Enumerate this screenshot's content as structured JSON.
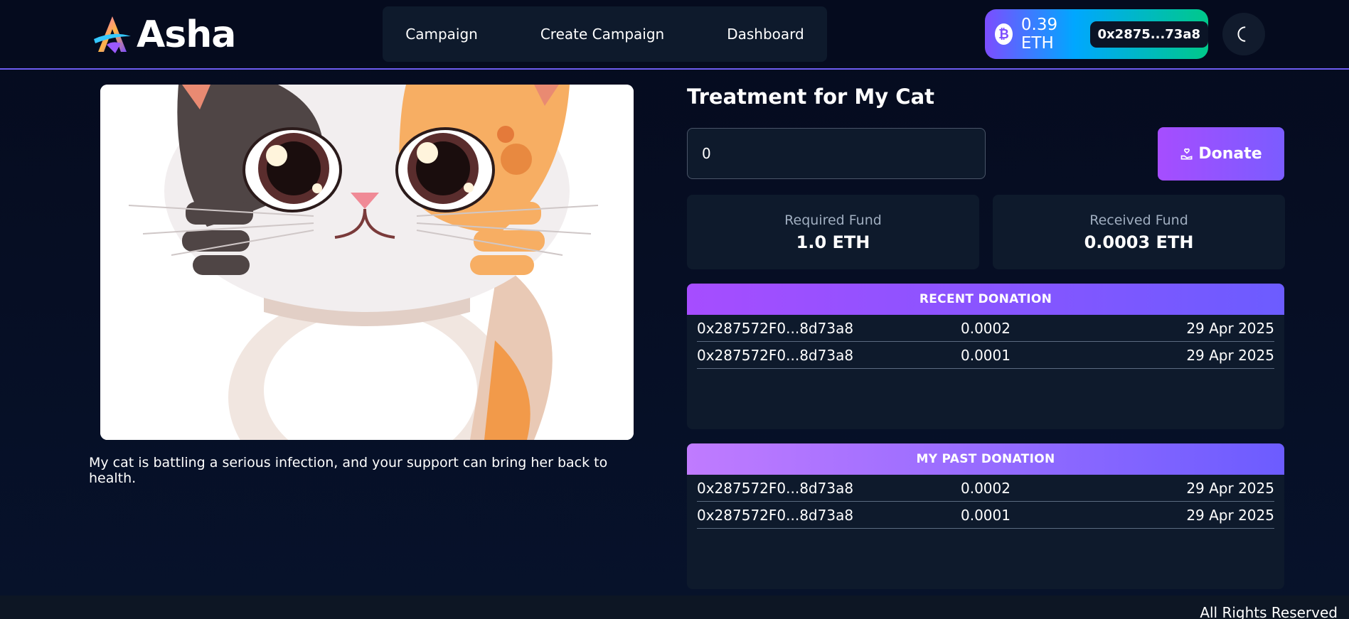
{
  "header": {
    "brand": "Asha",
    "nav": [
      "Campaign",
      "Create Campaign",
      "Dashboard"
    ],
    "wallet": {
      "coin_icon": "bitcoin-icon",
      "balance": "0.39 ETH",
      "address": "0x2875...73a8"
    },
    "theme_icon": "moon-icon"
  },
  "campaign": {
    "title": "Treatment for My Cat",
    "description": "My cat is battling a serious infection, and your support can bring her back to health.",
    "amount_value": "0",
    "donate_label": "Donate",
    "required_label": "Required Fund",
    "required_value": "1.0 ETH",
    "received_label": "Received Fund",
    "received_value": "0.0003 ETH"
  },
  "recent_donations": {
    "title": "RECENT DONATION",
    "rows": [
      {
        "address": "0x287572F0...8d73a8",
        "amount": "0.0002",
        "date": "29 Apr 2025"
      },
      {
        "address": "0x287572F0...8d73a8",
        "amount": "0.0001",
        "date": "29 Apr 2025"
      }
    ]
  },
  "past_donations": {
    "title": "MY PAST DONATION",
    "rows": [
      {
        "address": "0x287572F0...8d73a8",
        "amount": "0.0002",
        "date": "29 Apr 2025"
      },
      {
        "address": "0x287572F0...8d73a8",
        "amount": "0.0001",
        "date": "29 Apr 2025"
      }
    ]
  },
  "footer": {
    "text": "All Rights Reserved"
  },
  "colors": {
    "background": "#050b1e",
    "card": "#0e1a2c",
    "accent_purple": "#a64dff",
    "accent_blue": "#6c5cff",
    "wallet_green": "#00c98a"
  }
}
